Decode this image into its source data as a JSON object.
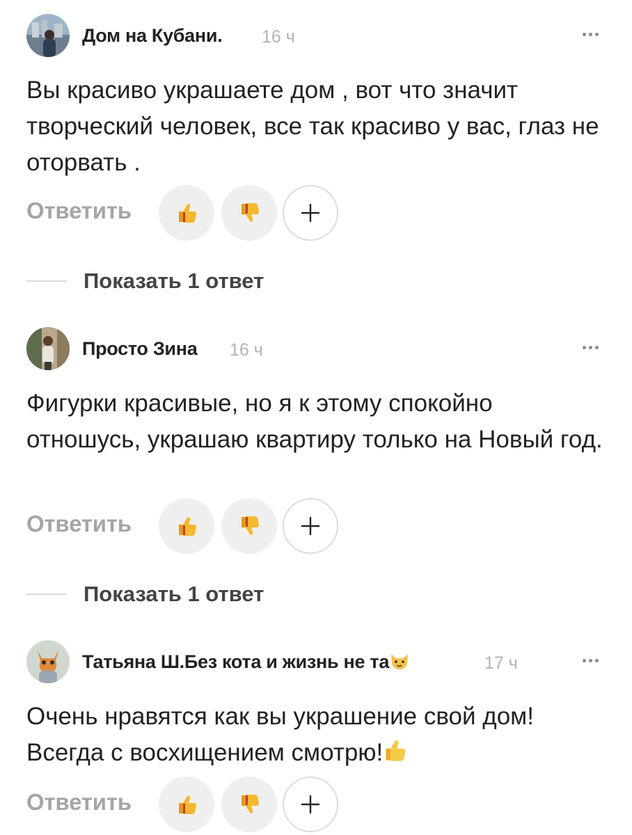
{
  "comments": [
    {
      "author": "Дом на Кубани.",
      "time": "16 ч",
      "text": "Вы красиво украшаете дом , вот что значит творческий человек, все так красиво у вас, глаз не оторвать .",
      "reply_label": "Ответить",
      "show_replies": "Показать 1 ответ",
      "avatar_icon": "avatar-photo-city-icon"
    },
    {
      "author": "Просто Зина",
      "time": "16 ч",
      "text": "Фигурки красивые, но я к этому спокойно отношусь, украшаю квартиру только на Новый год.",
      "reply_label": "Ответить",
      "show_replies": "Показать 1 ответ",
      "avatar_icon": "avatar-photo-woman-icon"
    },
    {
      "author": "Татьяна Ш.Без кота и жизнь не та",
      "time": "17 ч",
      "text": "Очень нравятся как вы украшение свой дом! Всегда с восхищением смотрю!",
      "reply_label": "Ответить",
      "avatar_icon": "avatar-photo-cat-icon"
    }
  ],
  "colors": {
    "reaction_bg": "#efefef",
    "secondary_text": "#a5a5a5",
    "thumb_yellow": "#f5b82e"
  }
}
